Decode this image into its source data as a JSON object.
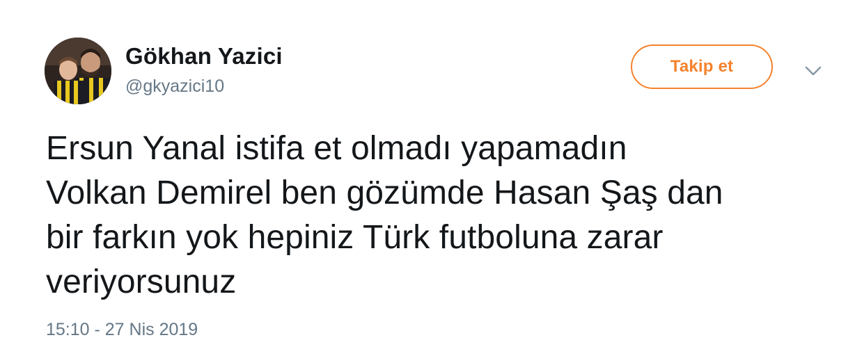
{
  "user": {
    "display_name": "Gökhan Yazici",
    "handle": "@gkyazici10",
    "avatar_icon": "profile-photo"
  },
  "actions": {
    "follow_label": "Takip et",
    "more_icon": "chevron-down-icon"
  },
  "tweet": {
    "lines": [
      "Ersun Yanal istifa et olmadı yapamadın",
      "Volkan Demirel ben gözümde Hasan Şaş dan",
      "bir farkın yok hepiniz Türk futboluna zarar",
      "veriyorsunuz"
    ],
    "timestamp": "15:10 - 27 Nis 2019"
  },
  "colors": {
    "accent": "#f5822d",
    "text": "#14171a",
    "secondary_text": "#657786"
  }
}
